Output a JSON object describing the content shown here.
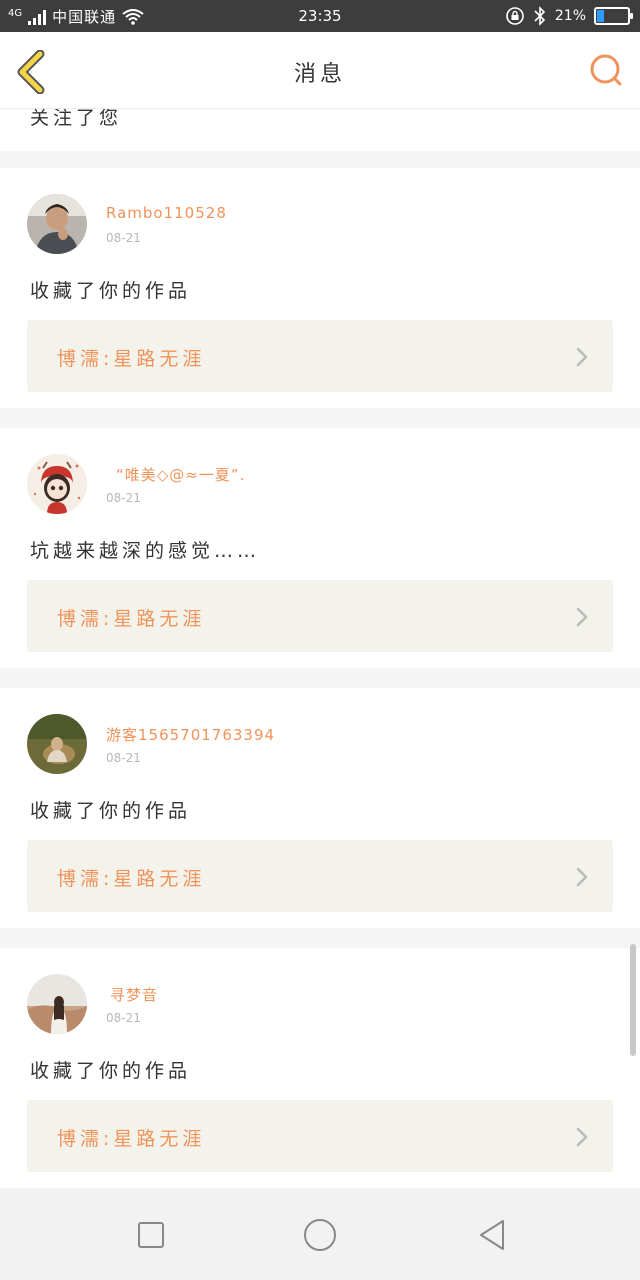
{
  "status_bar": {
    "network": "4G",
    "carrier": "中国联通",
    "time": "23:35",
    "battery": "21%",
    "battery_level": 0.21,
    "wifi_icon": "wifi-icon",
    "rotation_icon": "rotation-lock-icon",
    "bluetooth_icon": "bluetooth-icon"
  },
  "header": {
    "title": "消息",
    "back_icon": "chevron-left-icon",
    "search_icon": "search-icon"
  },
  "colors": {
    "accent": "#f0935a",
    "back_icon": "#f5d547",
    "card_link_bg": "#f3f3ec",
    "divider": "#f5f5f5",
    "status_bar_bg": "#3d3d3d"
  },
  "partial_item": {
    "message": "关注了您"
  },
  "messages": [
    {
      "username": "Rambo110528",
      "date": "08-21",
      "message": "收藏了你的作品",
      "work_title": "博濡:星路无涯"
    },
    {
      "username": "“唯美◇@≈一夏”.",
      "date": "08-21",
      "message": "坑越来越深的感觉……",
      "work_title": "博濡:星路无涯"
    },
    {
      "username": "游客1565701763394",
      "date": "08-21",
      "message": "收藏了你的作品",
      "work_title": "博濡:星路无涯"
    },
    {
      "username": "寻梦音",
      "date": "08-21",
      "message": "收藏了你的作品",
      "work_title": "博濡:星路无涯"
    }
  ],
  "nav_bar": {
    "recent_icon": "square-icon",
    "home_icon": "circle-icon",
    "back_icon": "triangle-back-icon"
  }
}
